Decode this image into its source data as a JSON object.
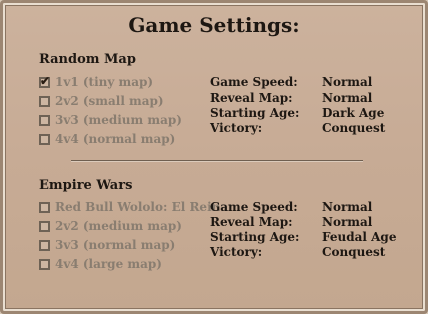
{
  "title": "Game Settings:",
  "random_map": {
    "heading": "Random Map",
    "options": [
      {
        "label": "1v1 (tiny map)",
        "checked": true
      },
      {
        "label": "2v2 (small map)",
        "checked": false
      },
      {
        "label": "3v3 (medium map)",
        "checked": false
      },
      {
        "label": "4v4 (normal map)",
        "checked": false
      }
    ],
    "settings": [
      {
        "key": "Game Speed:",
        "value": "Normal"
      },
      {
        "key": "Reveal Map:",
        "value": "Normal"
      },
      {
        "key": "Starting Age:",
        "value": "Dark Age"
      },
      {
        "key": "Victory:",
        "value": "Conquest"
      }
    ]
  },
  "empire_wars": {
    "heading": "Empire Wars",
    "options": [
      {
        "label": "Red Bull Wololo: El Reina",
        "checked": false
      },
      {
        "label": "2v2 (medium map)",
        "checked": false
      },
      {
        "label": "3v3 (normal map)",
        "checked": false
      },
      {
        "label": "4v4 (large map)",
        "checked": false
      }
    ],
    "settings": [
      {
        "key": "Game Speed:",
        "value": "Normal"
      },
      {
        "key": "Reveal Map:",
        "value": "Normal"
      },
      {
        "key": "Starting Age:",
        "value": "Feudal Age"
      },
      {
        "key": "Victory:",
        "value": "Conquest"
      }
    ]
  },
  "icons": {
    "checked": "✔"
  }
}
